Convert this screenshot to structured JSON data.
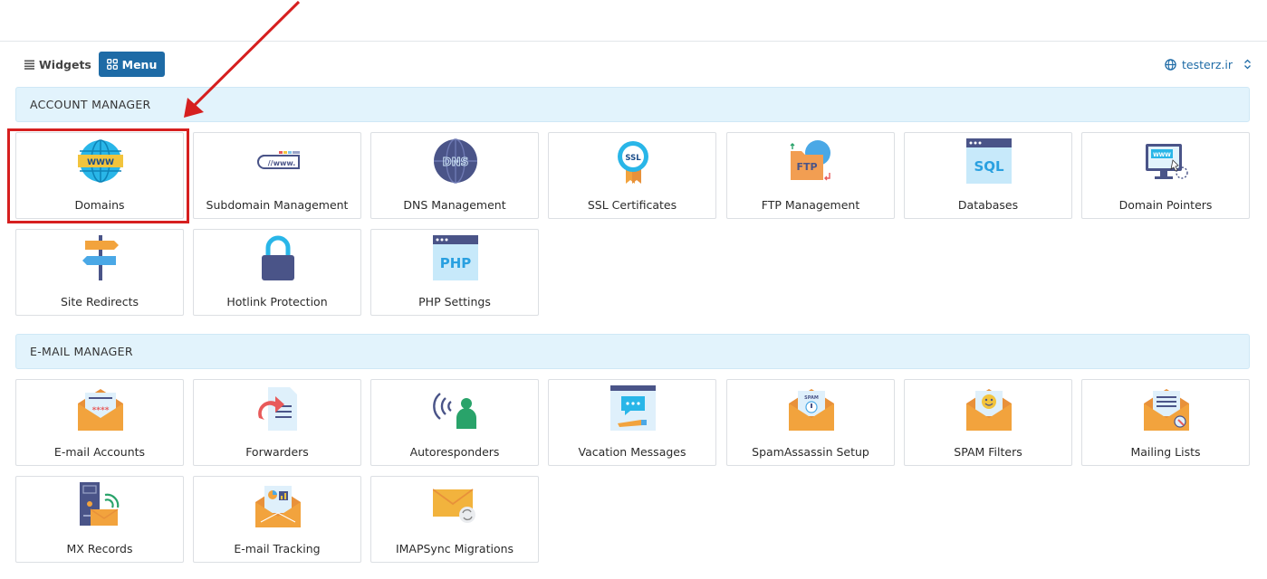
{
  "view_toggle": {
    "widgets_label": "Widgets",
    "menu_label": "Menu"
  },
  "domain_selector": {
    "value": "testerz.ir"
  },
  "sections": {
    "account": {
      "title": "ACCOUNT MANAGER",
      "items": [
        {
          "label": "Domains",
          "icon": "domains-globe-icon"
        },
        {
          "label": "Subdomain Management",
          "icon": "subdomain-icon"
        },
        {
          "label": "DNS Management",
          "icon": "dns-globe-icon"
        },
        {
          "label": "SSL Certificates",
          "icon": "ssl-badge-icon"
        },
        {
          "label": "FTP Management",
          "icon": "ftp-folder-icon"
        },
        {
          "label": "Databases",
          "icon": "sql-database-icon"
        },
        {
          "label": "Domain Pointers",
          "icon": "domain-pointer-monitor-icon"
        },
        {
          "label": "Site Redirects",
          "icon": "signpost-icon"
        },
        {
          "label": "Hotlink Protection",
          "icon": "padlock-icon"
        },
        {
          "label": "PHP Settings",
          "icon": "php-window-icon"
        }
      ]
    },
    "email": {
      "title": "E-MAIL MANAGER",
      "items": [
        {
          "label": "E-mail Accounts",
          "icon": "email-password-envelope-icon"
        },
        {
          "label": "Forwarders",
          "icon": "forward-document-icon"
        },
        {
          "label": "Autoresponders",
          "icon": "autoresponder-person-icon"
        },
        {
          "label": "Vacation Messages",
          "icon": "vacation-message-icon"
        },
        {
          "label": "SpamAssassin Setup",
          "icon": "spam-envelope-icon"
        },
        {
          "label": "SPAM Filters",
          "icon": "spam-filter-envelope-icon"
        },
        {
          "label": "Mailing Lists",
          "icon": "mailing-list-envelope-icon"
        },
        {
          "label": "MX Records",
          "icon": "mx-server-icon"
        },
        {
          "label": "E-mail Tracking",
          "icon": "email-tracking-icon"
        },
        {
          "label": "IMAPSync Migrations",
          "icon": "imapsync-envelope-icon"
        }
      ]
    }
  },
  "colors": {
    "accent": "#1e6ba6",
    "section_bg": "#e2f3fc",
    "highlight": "#d61f1f"
  }
}
